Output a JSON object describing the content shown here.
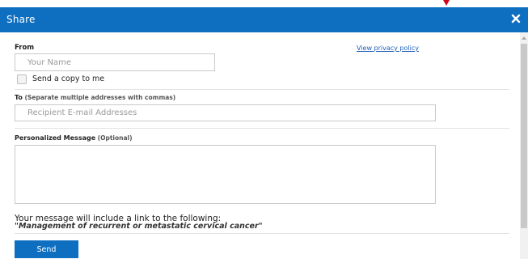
{
  "dialog": {
    "title": "Share",
    "close_icon": "close-icon"
  },
  "from": {
    "label": "From",
    "name_placeholder": "Your Name",
    "name_value": "",
    "copy_checkbox_label": "Send a copy to me",
    "copy_checked": false
  },
  "privacy_link": "View privacy policy",
  "to": {
    "label": "To",
    "note": "(Separate multiple addresses with commas)",
    "placeholder": "Recipient E-mail Addresses",
    "value": ""
  },
  "message": {
    "label": "Personalized Message",
    "note": "(Optional)",
    "value": ""
  },
  "info": {
    "line1": "Your message will include a link to the following:",
    "line2": "\"Management of recurrent or metastatic cervical cancer\""
  },
  "send_label": "Send",
  "colors": {
    "header": "#0e6fc1",
    "link": "#1f5fb5",
    "marker": "#d0021b"
  }
}
